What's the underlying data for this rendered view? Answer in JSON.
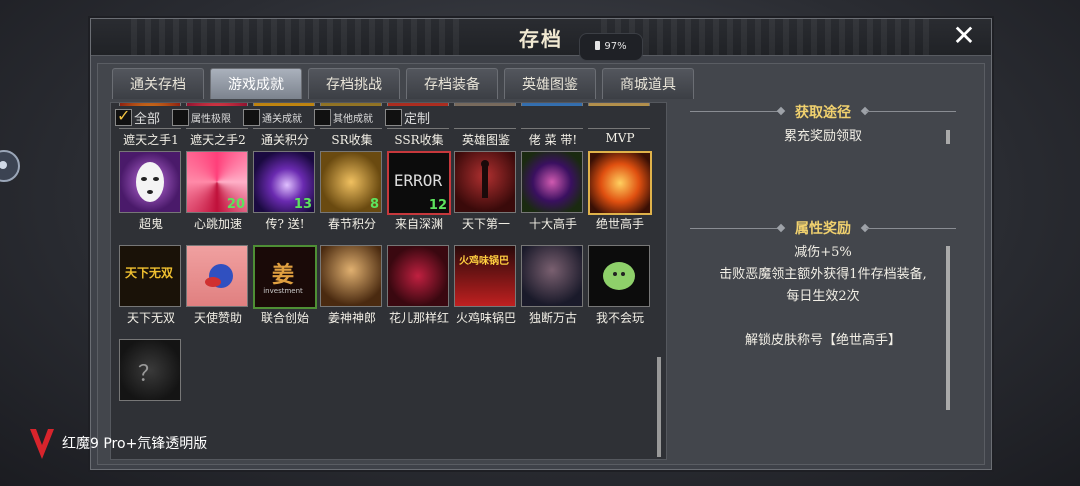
{
  "window": {
    "title": "存档",
    "battery": "97%"
  },
  "tabs": [
    "通关存档",
    "游戏成就",
    "存档挑战",
    "存档装备",
    "英雄图鉴",
    "商城道具"
  ],
  "active_tab": 1,
  "filters": [
    {
      "label": "全部",
      "checked": true
    },
    {
      "label": "属性极限",
      "checked": false
    },
    {
      "label": "通关成就",
      "checked": false
    },
    {
      "label": "其他成就",
      "checked": false
    },
    {
      "label": "定制",
      "checked": false
    }
  ],
  "row1": [
    "遮天之手1",
    "遮天之手2",
    "通关积分",
    "SR收集",
    "SSR收集",
    "英雄图鉴",
    "佬 菜 带!",
    "MVP"
  ],
  "row2": [
    {
      "label": "超鬼",
      "count": ""
    },
    {
      "label": "心跳加速",
      "count": "20"
    },
    {
      "label": "传? 送!",
      "count": "13"
    },
    {
      "label": "春节积分",
      "count": "8"
    },
    {
      "label": "来自深渊",
      "count": "12",
      "text": "ERROR"
    },
    {
      "label": "天下第一",
      "count": ""
    },
    {
      "label": "十大高手",
      "count": ""
    },
    {
      "label": "绝世高手",
      "count": ""
    }
  ],
  "row3": [
    "天下无双",
    "天使赞助",
    "联合创始",
    "姜神神郎",
    "花儿那样红",
    "火鸡味锅巴",
    "独断万古",
    "我不会玩"
  ],
  "row4": [
    "？"
  ],
  "icon_texts": {
    "tianxia": "天下无双",
    "jiang": "姜",
    "jiang_sub": "investment",
    "huoji": "火鸡味锅巴"
  },
  "right": {
    "source_title": "获取途径",
    "source_text": "累充奖励领取",
    "reward_title": "属性奖励",
    "reward_lines": [
      "减伤+5%",
      "击败恶魔领主额外获得1件存档装备,",
      "每日生效2次",
      "",
      "解锁皮肤称号【绝世高手】"
    ]
  },
  "brand": {
    "text": "红魔9 Pro+氘锋透明版"
  },
  "colors": {
    "accent_gold": "#f1d16e",
    "selected_border": "#e0b24a",
    "count_green": "#5de35d"
  }
}
